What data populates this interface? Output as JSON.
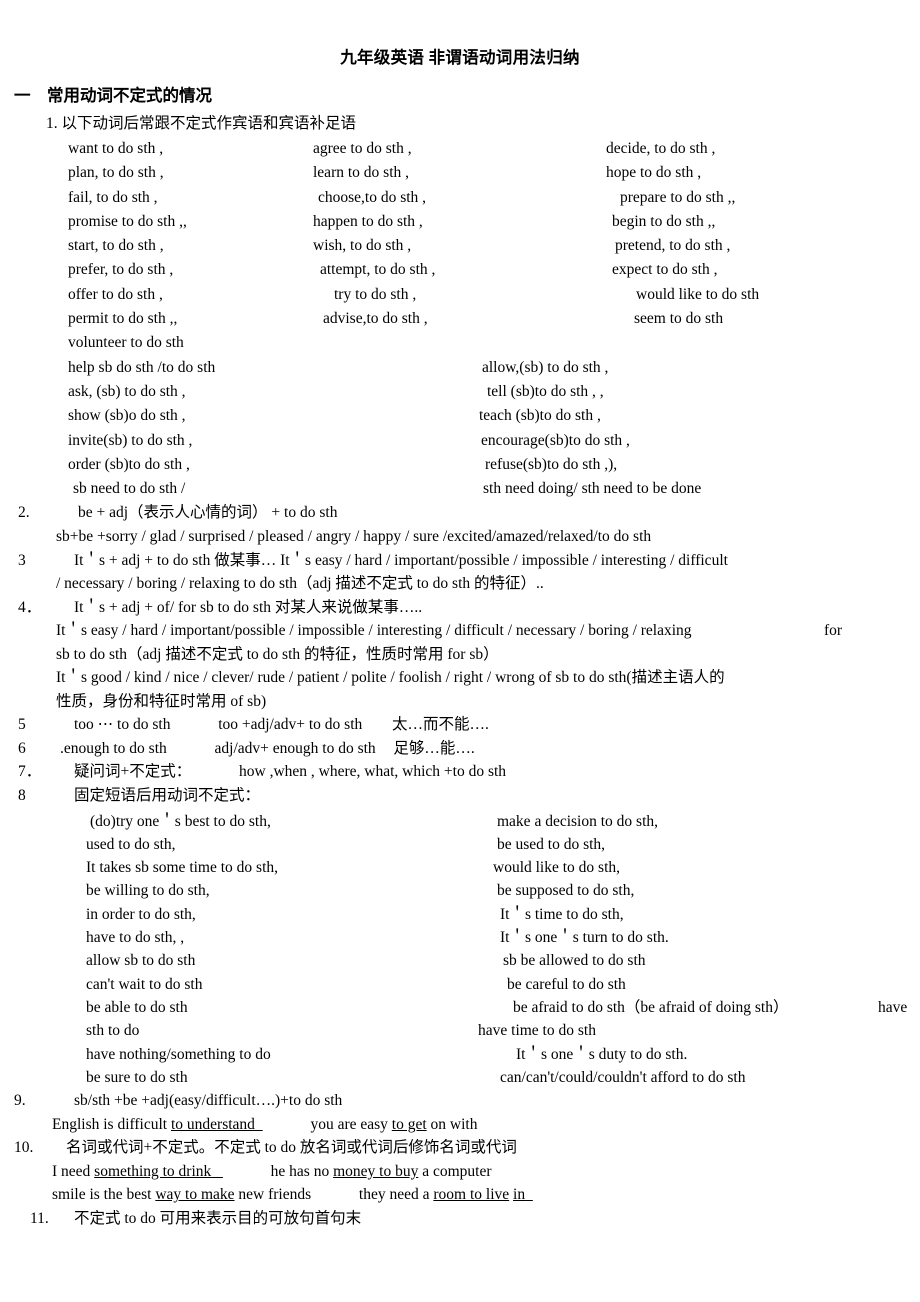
{
  "doc": {
    "title": "九年级英语 非谓语动词用法归纳",
    "section1_heading": "一　常用动词不定式的情况",
    "item1_heading": "1. 以下动词后常跟不定式作宾语和宾语补足语"
  },
  "verb_grid": {
    "rows": [
      [
        "want to do sth ,",
        "agree to do sth ,",
        "decide, to do sth ,"
      ],
      [
        "plan, to do sth ,",
        "learn to do sth ,",
        "hope to do sth ,"
      ],
      [
        "fail, to do sth ,",
        "choose,to do sth ,",
        "prepare to do sth ,,"
      ],
      [
        "promise to do sth ,,",
        "happen to do sth ,",
        "begin to do sth ,,"
      ],
      [
        "start, to do sth ,",
        "wish, to do sth ,",
        "pretend, to do sth ,"
      ],
      [
        "prefer, to do sth ,",
        "attempt, to do sth ,",
        "expect to do sth ,"
      ],
      [
        "offer to do sth ,",
        "try to do sth ,",
        "would like to do sth"
      ],
      [
        "permit to do sth ,,",
        "advise,to do sth ,",
        "seem to do sth"
      ],
      [
        "volunteer to do sth",
        "",
        ""
      ]
    ]
  },
  "sb_grid": {
    "rows": [
      [
        "help sb do sth /to do sth",
        "allow,(sb) to do sth ,"
      ],
      [
        "ask, (sb) to do sth ,",
        "tell (sb)to do sth , ,"
      ],
      [
        "show (sb)o do sth ,",
        "teach (sb)to do sth ,"
      ],
      [
        "invite(sb) to do sth ,",
        "encourage(sb)to do sth ,"
      ],
      [
        "order (sb)to do sth ,",
        "refuse(sb)to do sth ,),"
      ],
      [
        "sb need to do sth /",
        "sth need doing/ sth need to be done"
      ]
    ]
  },
  "items": {
    "n2": "2.",
    "i2_line1": "be + adj（表示人心情的词）  + to do sth",
    "i2_line2": "sb+be +sorry / glad / surprised / pleased / angry / happy / sure /excited/amazed/relaxed/to do sth",
    "n3": "3",
    "i3_line1": "It＇s + adj + to do sth  做某事… It＇s easy / hard / important/possible / impossible / interesting / difficult",
    "i3_line2": "/ necessary / boring / relaxing   to do sth（adj 描述不定式 to do sth 的特征）..",
    "n4": "4．",
    "i4_line1": "It＇s + adj + of/ for sb to do sth  对某人来说做某事…..",
    "i4_line2a": "It＇s easy / hard / important/possible / impossible / interesting / difficult / necessary / boring / relaxing",
    "i4_line2b": "for",
    "i4_line3": "sb to do sth（adj 描述不定式 to do sth 的特征，性质时常用 for sb）",
    "i4_line4": "It＇s good / kind / nice / clever/ rude / patient / polite / foolish / right / wrong of sb to do sth(描述主语人的",
    "i4_line5": "性质，身份和特征时常用 of sb)",
    "n5": "5",
    "i5_a": "too ⋯ to do sth",
    "i5_b": "too +adj/adv+ to do sth",
    "i5_c": "太…而不能….",
    "n6": "6",
    "i6_a": ".enough to do sth",
    "i6_b": "adj/adv+ enough to do sth",
    "i6_c": "足够…能….",
    "n7": "7．",
    "i7_a": "疑问词+不定式：",
    "i7_b": "how ,when , where, what, which +to do sth",
    "n8": "8",
    "i8": "固定短语后用动词不定式：",
    "n9": "9.",
    "i9_line1": "sb/sth +be +adj(easy/difficult….)+to do sth",
    "i9_line2a": "English is difficult",
    "i9_line2b": "to understand",
    "i9_line2c": "you are easy",
    "i9_line2d": "to get",
    "i9_line2e": "on with",
    "n10": "10.",
    "i10_line1": "名词或代词+不定式。不定式 to do  放名词或代词后修饰名词或代词",
    "i10_line2a": "I need",
    "i10_line2b": "something to drink",
    "i10_line2c": "he has no",
    "i10_line2d": "money to buy",
    "i10_line2e": "a computer",
    "i10_line3a": "smile is the best",
    "i10_line3b": "way to make",
    "i10_line3c": "new friends",
    "i10_line3d": "they need a",
    "i10_line3e": "room to live",
    "i10_line3f": "in",
    "n11": "11.",
    "i11": "不定式 to do  可用来表示目的可放句首句末"
  },
  "phrase_grid": {
    "rows": [
      [
        "(do)try one＇s best to do sth,",
        "make a decision to do sth,",
        ""
      ],
      [
        "used to do sth,",
        "be used to do sth,",
        ""
      ],
      [
        "It takes sb some time to do sth,",
        "would like to do sth,",
        ""
      ],
      [
        "be willing to do sth,",
        "be supposed to do sth,",
        ""
      ],
      [
        "in order to do sth,",
        "It＇s time to do sth,",
        ""
      ],
      [
        "have to do sth, ,",
        "It＇s one＇s turn to do sth.",
        ""
      ],
      [
        "allow sb to do sth",
        "sb be allowed to do sth",
        ""
      ],
      [
        "can't wait to do sth",
        "be careful to do sth",
        ""
      ],
      [
        "be able to do sth",
        "be afraid to do sth（be afraid of doing sth）",
        "have"
      ],
      [
        "sth to do",
        "have time to do sth",
        ""
      ],
      [
        "have nothing/something   to do",
        "It＇s one＇s duty   to do sth.",
        ""
      ],
      [
        "be sure to do sth",
        "can/can't/could/couldn't   afford   to do sth",
        ""
      ]
    ]
  }
}
